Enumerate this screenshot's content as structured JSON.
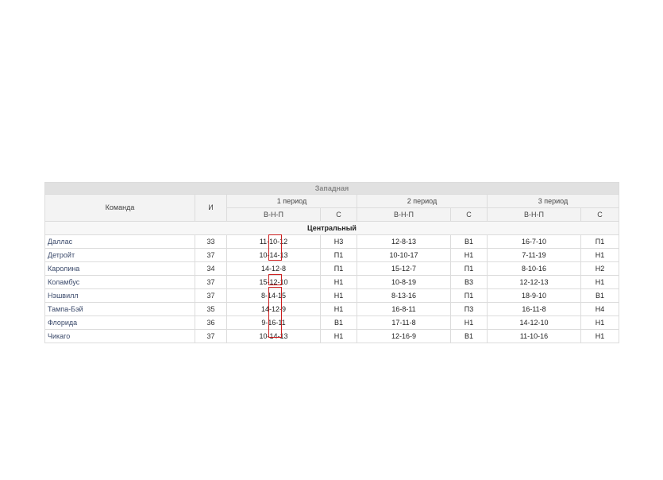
{
  "table": {
    "conference": "Западная",
    "headers": {
      "team": "Команда",
      "games": "И",
      "periods": [
        "1 период",
        "2 период",
        "3 период"
      ],
      "record": "В-Н-П",
      "series": "С"
    },
    "division": "Центральный",
    "rows": [
      {
        "team": "Даллас",
        "games": "33",
        "p1": "11-10-12",
        "s1": "Н3",
        "p2": "12-8-13",
        "s2": "В1",
        "p3": "16-7-10",
        "s3": "П1"
      },
      {
        "team": "Детройт",
        "games": "37",
        "p1": "10-14-13",
        "s1": "П1",
        "p2": "10-10-17",
        "s2": "Н1",
        "p3": "7-11-19",
        "s3": "Н1"
      },
      {
        "team": "Каролина",
        "games": "34",
        "p1": "14-12-8",
        "s1": "П1",
        "p2": "15-12-7",
        "s2": "П1",
        "p3": "8-10-16",
        "s3": "Н2"
      },
      {
        "team": "Коламбус",
        "games": "37",
        "p1": "15-12-10",
        "s1": "Н1",
        "p2": "10-8-19",
        "s2": "В3",
        "p3": "12-12-13",
        "s3": "Н1"
      },
      {
        "team": "Нэшвилл",
        "games": "37",
        "p1": "8-14-15",
        "s1": "Н1",
        "p2": "8-13-16",
        "s2": "П1",
        "p3": "18-9-10",
        "s3": "В1"
      },
      {
        "team": "Тампа-Бэй",
        "games": "35",
        "p1": "14-12-9",
        "s1": "Н1",
        "p2": "16-8-11",
        "s2": "П3",
        "p3": "16-11-8",
        "s3": "Н4"
      },
      {
        "team": "Флорида",
        "games": "36",
        "p1": "9-16-11",
        "s1": "В1",
        "p2": "17-11-8",
        "s2": "Н1",
        "p3": "14-12-10",
        "s3": "Н1"
      },
      {
        "team": "Чикаго",
        "games": "37",
        "p1": "10-14-13",
        "s1": "Н1",
        "p2": "12-16-9",
        "s2": "В1",
        "p3": "11-10-16",
        "s3": "Н1"
      }
    ]
  },
  "highlight_color": "#cc1f1f"
}
